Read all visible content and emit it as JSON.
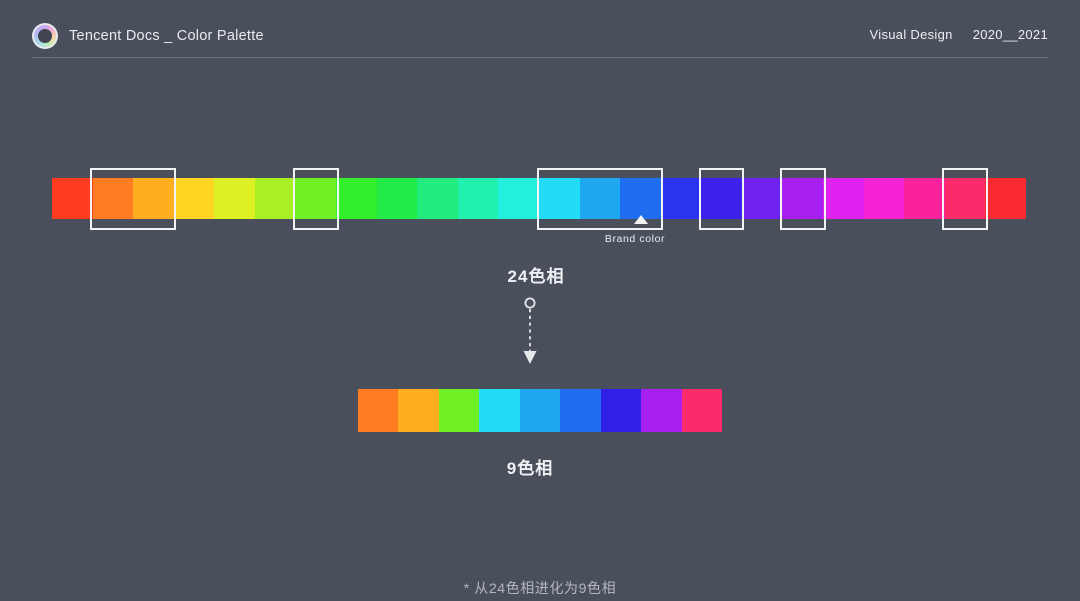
{
  "header": {
    "logo_icon": "color-wheel-icon",
    "title": "Tencent Docs _ Color Palette",
    "department": "Visual Design",
    "years": "2020__2021"
  },
  "palette24": {
    "caption": "24色相",
    "count": 24,
    "colors": [
      "#FF3B20",
      "#FF7D20",
      "#FFAE1F",
      "#FFD524",
      "#DCF024",
      "#A8F024",
      "#6EF024",
      "#33EE2A",
      "#22EA49",
      "#22EC7E",
      "#22F0AE",
      "#22F0DC",
      "#22DCF5",
      "#1FA8F0",
      "#1F6EF0",
      "#2A33EE",
      "#3C22EA",
      "#7022F0",
      "#A820F0",
      "#E022F0",
      "#F522D8",
      "#FA229B",
      "#FA2A6B",
      "#FA2A33"
    ],
    "brand_color_label": "Brand color",
    "brand_color_index": 15,
    "brand_color_hex": "#2A33EE",
    "highlight_groups": [
      {
        "start_index": 1,
        "span": 2
      },
      {
        "start_index": 6,
        "span": 1
      },
      {
        "start_index": 12,
        "span": 3
      },
      {
        "start_index": 16,
        "span": 1
      },
      {
        "start_index": 18,
        "span": 1
      },
      {
        "start_index": 22,
        "span": 1
      }
    ]
  },
  "palette9": {
    "caption": "9色相",
    "count": 9,
    "colors": [
      "#FF7D20",
      "#FFAE1F",
      "#6EF024",
      "#22DCF5",
      "#1FA8F0",
      "#1F6EF0",
      "#3220E8",
      "#A820F0",
      "#FA2A6B"
    ]
  },
  "connector": {
    "icon": "dashed-arrow-down-icon"
  },
  "footnote": "* 从24色相进化为9色相",
  "theme": {
    "background": "#4a4f5c",
    "text": "#f0f1f4",
    "muted_text": "#b3b6bd",
    "rule": "#6a6f7c",
    "highlight_stroke": "#f2f3f5"
  }
}
